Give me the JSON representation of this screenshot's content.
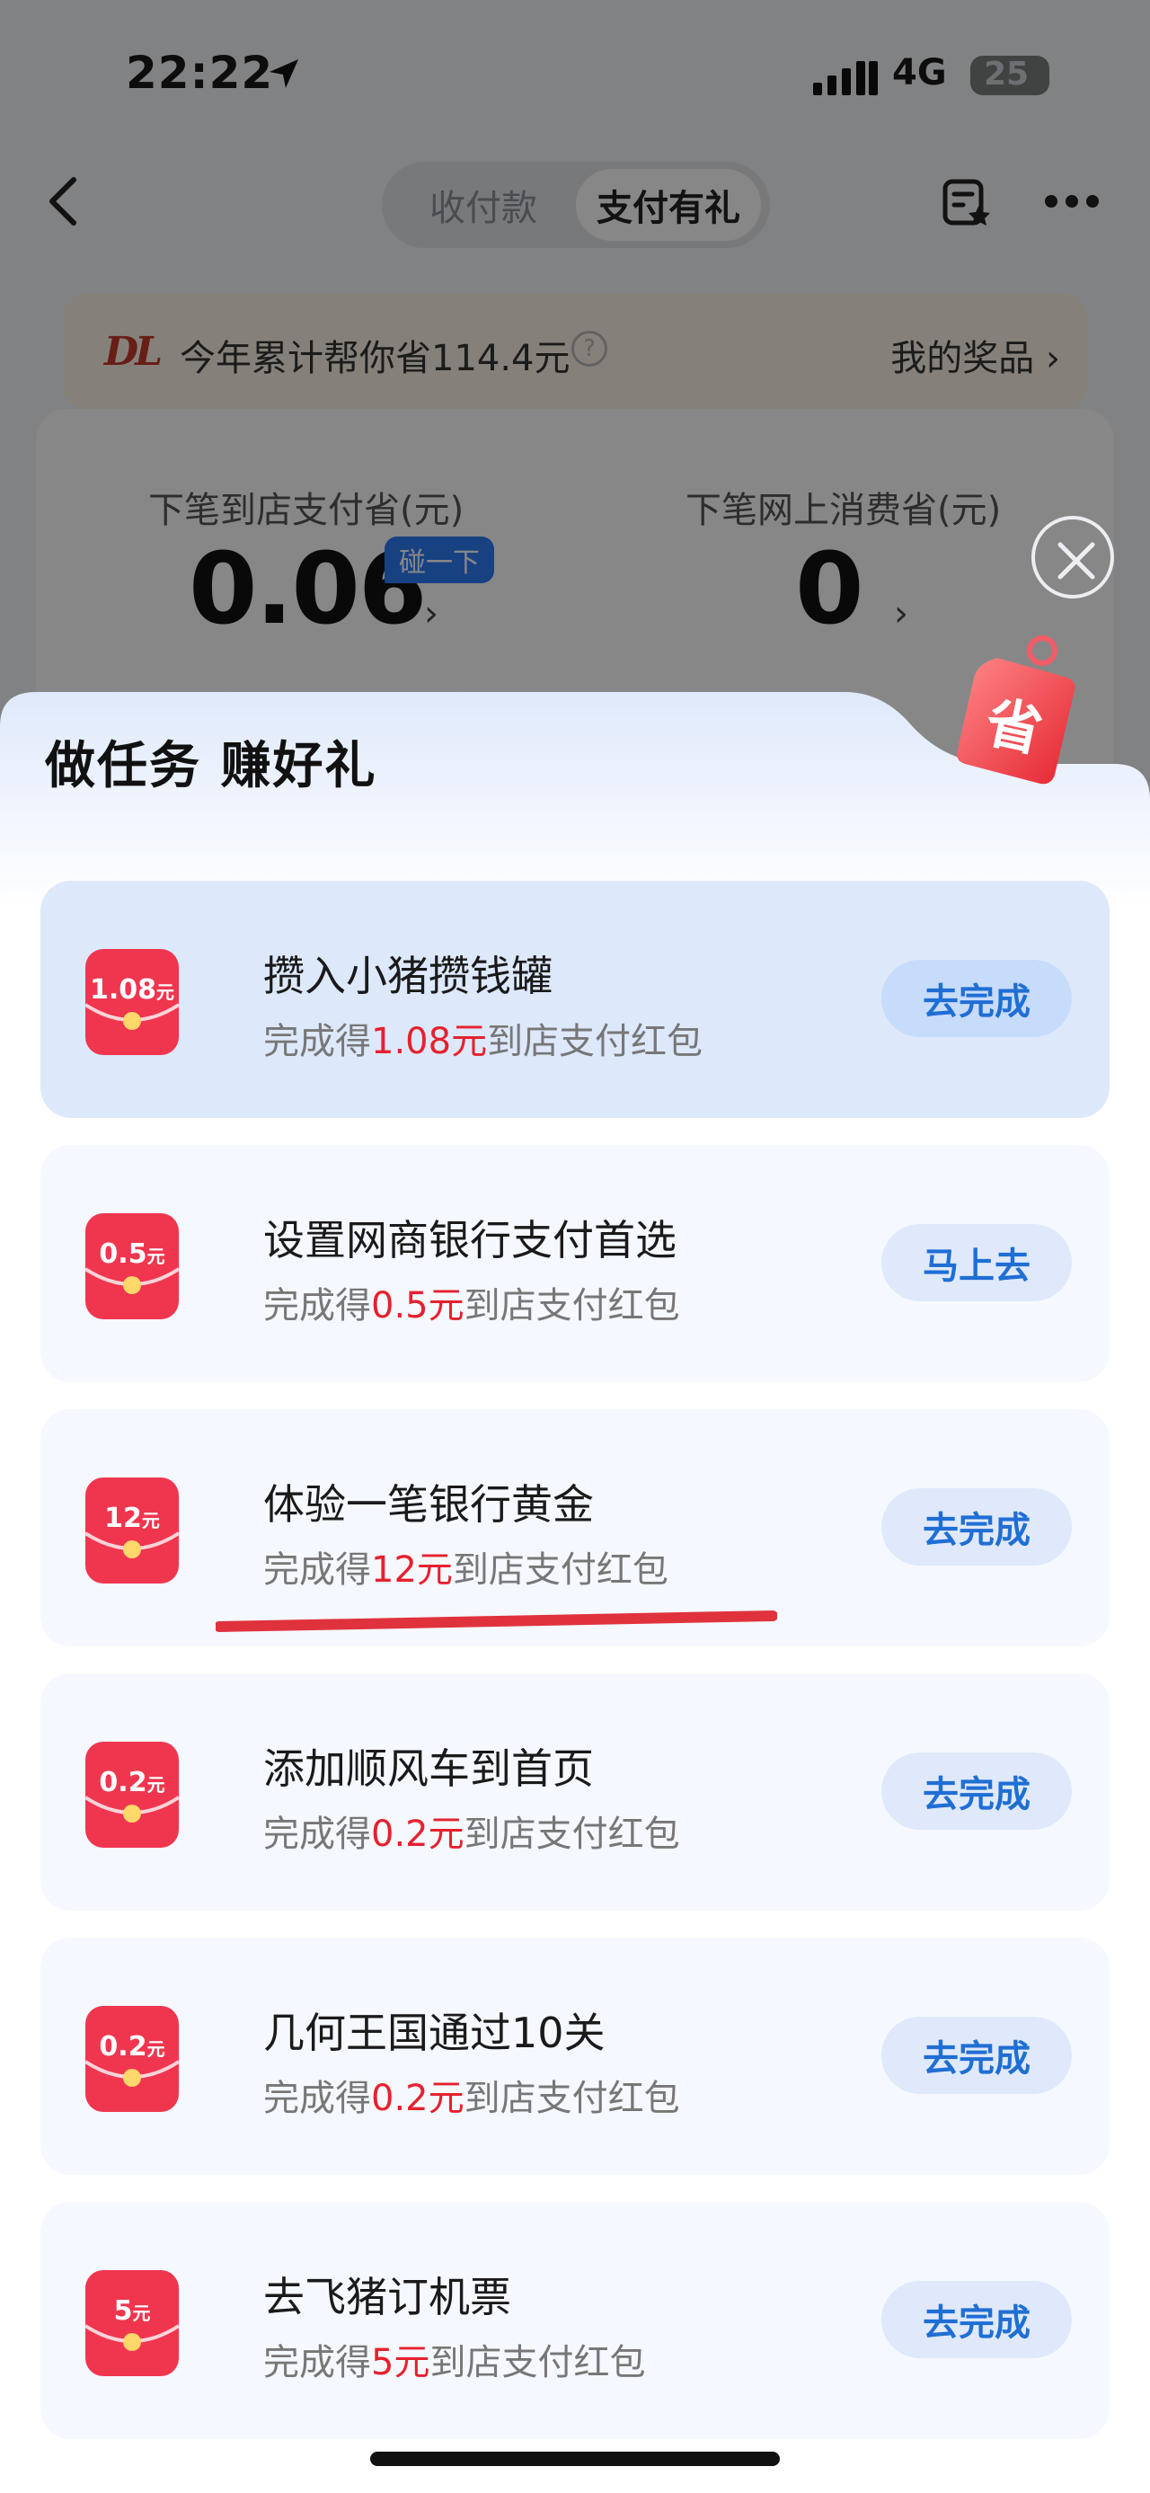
{
  "status_bar": {
    "time": "22:22",
    "network": "4G",
    "battery": "25"
  },
  "nav": {
    "tabs": [
      {
        "label": "收付款"
      },
      {
        "label": "支付有礼"
      }
    ]
  },
  "savings": {
    "logo": "DL",
    "text": "今年累计帮你省114.4元",
    "prizes_link": "我的奖品 ›"
  },
  "stats": {
    "left_label": "下笔到店支付省(元)",
    "left_value": "0.06",
    "tap_badge": "碰一下",
    "right_label": "下笔网上消费省(元)",
    "right_value": "0",
    "chevron": "›"
  },
  "sheet": {
    "title": "做任务 赚好礼",
    "tag_text": "省",
    "tasks": [
      {
        "env_amount": "1.08",
        "env_unit": "元",
        "title": "攒入小猪攒钱罐",
        "sub_prefix": "完成得",
        "sub_amount": "1.08元",
        "sub_suffix": "到店支付红包",
        "button": "去完成"
      },
      {
        "env_amount": "0.5",
        "env_unit": "元",
        "title": "设置网商银行支付首选",
        "sub_prefix": "完成得",
        "sub_amount": "0.5元",
        "sub_suffix": "到店支付红包",
        "button": "马上去"
      },
      {
        "env_amount": "12",
        "env_unit": "元",
        "title": "体验一笔银行黄金",
        "sub_prefix": "完成得",
        "sub_amount": "12元",
        "sub_suffix": "到店支付红包",
        "button": "去完成"
      },
      {
        "env_amount": "0.2",
        "env_unit": "元",
        "title": "添加顺风车到首页",
        "sub_prefix": "完成得",
        "sub_amount": "0.2元",
        "sub_suffix": "到店支付红包",
        "button": "去完成"
      },
      {
        "env_amount": "0.2",
        "env_unit": "元",
        "title": "几何王国通过10关",
        "sub_prefix": "完成得",
        "sub_amount": "0.2元",
        "sub_suffix": "到店支付红包",
        "button": "去完成"
      },
      {
        "env_amount": "5",
        "env_unit": "元",
        "title": "去飞猪订机票",
        "sub_prefix": "完成得",
        "sub_amount": "5元",
        "sub_suffix": "到店支付红包",
        "button": "去完成"
      }
    ]
  },
  "colors": {
    "accent_blue": "#1f6ed4",
    "reward_red": "#e5212e",
    "envelope_red": "#f0364f",
    "highlight_card": "#dde8fb"
  },
  "icons": [
    "location-arrow-icon",
    "cellular-signal-icon",
    "back-chevron-icon",
    "star-list-icon",
    "more-dots-icon",
    "help-circle-icon",
    "close-icon",
    "red-envelope-icon",
    "savings-tag-icon"
  ]
}
